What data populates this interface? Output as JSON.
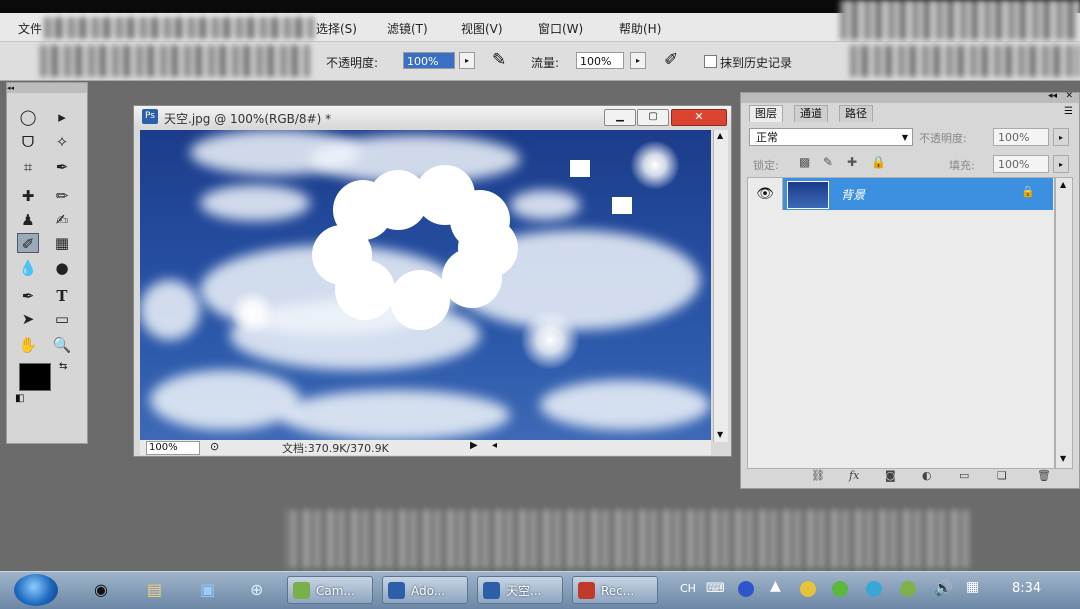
{
  "menu": {
    "items": [
      {
        "id": "file",
        "label": "文件"
      },
      {
        "id": "select",
        "label": "选择(S)"
      },
      {
        "id": "filter",
        "label": "滤镜(T)"
      },
      {
        "id": "view",
        "label": "视图(V)"
      },
      {
        "id": "window",
        "label": "窗口(W)"
      },
      {
        "id": "help",
        "label": "帮助(H)"
      }
    ]
  },
  "options": {
    "opacity_label": "不透明度:",
    "opacity_value": "100%",
    "flow_label": "流量:",
    "flow_value": "100%",
    "history_label": "抹到历史记录",
    "history_checked": false
  },
  "document": {
    "title": "天空.jpg @ 100%(RGB/8#) *",
    "zoom": "100%",
    "doc_info": "文档:370.9K/370.9K"
  },
  "layers_panel": {
    "tabs": [
      {
        "id": "layers",
        "label": "图层",
        "active": true
      },
      {
        "id": "channels",
        "label": "通道",
        "active": false
      },
      {
        "id": "paths",
        "label": "路径",
        "active": false
      }
    ],
    "blend_mode": "正常",
    "opacity_label": "不透明度:",
    "opacity_value": "100%",
    "lock_label": "锁定:",
    "fill_label": "填充:",
    "fill_value": "100%",
    "layers": [
      {
        "name": "背景",
        "visible": true,
        "locked": true,
        "selected": true
      }
    ]
  },
  "taskbar": {
    "buttons": [
      {
        "id": "camtasia",
        "label": "Cam...",
        "icon_color": "#7ab04a"
      },
      {
        "id": "adobe",
        "label": "Ado...",
        "icon_color": "#2c5fa8"
      },
      {
        "id": "tiankong",
        "label": "天空...",
        "icon_color": "#2c5fa8"
      },
      {
        "id": "recorder",
        "label": "Rec...",
        "icon_color": "#c0392b"
      }
    ],
    "lang": "CH",
    "clock": "8:34"
  },
  "colors": {
    "selection_blue": "#3d8fe0",
    "ps_blue": "#2c5fa8",
    "close_red": "#d9432f"
  }
}
